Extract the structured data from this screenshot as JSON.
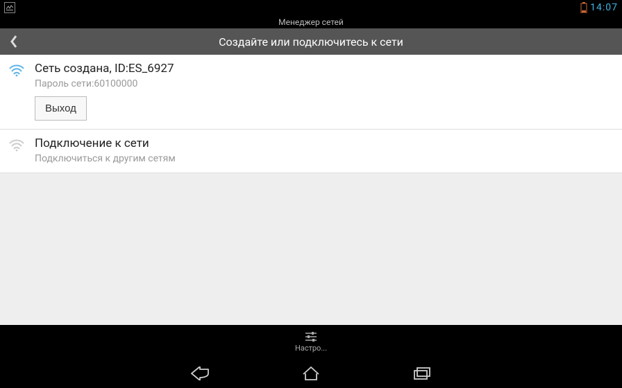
{
  "status_bar": {
    "time": "14:07"
  },
  "app_bar": {
    "title": "Менеджер сетей"
  },
  "header": {
    "title": "Создайте или подключитесь к сети"
  },
  "items": [
    {
      "title": "Сеть создана, ID:ES_6927",
      "subtitle": "Пароль сети:60100000",
      "button_label": "Выход"
    },
    {
      "title": "Подключение к сети",
      "subtitle": "Подключиться к другим сетям"
    }
  ],
  "bottom": {
    "settings_label": "Настро..."
  }
}
